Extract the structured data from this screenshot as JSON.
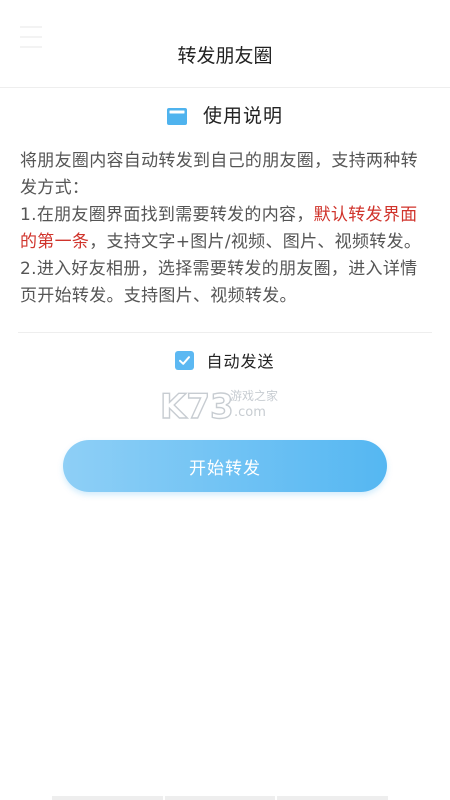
{
  "header": {
    "title": "转发朋友圈"
  },
  "instructions": {
    "title": "使用说明",
    "icon": "folder-icon",
    "accent_color": "#5cb8f2",
    "text_part1": "将朋友圈内容自动转发到自己的朋友圈，支持两种转发方式：",
    "text_part2": "1.在朋友圈界面找到需要转发的内容，",
    "text_highlight": "默认转发界面的第一条",
    "text_part3": "，支持文字+图片/视频、图片、视频转发。",
    "text_part4": "2.进入好友相册，选择需要转发的朋友圈，进入详情页开始转发。支持图片、视频转发。",
    "highlight_color": "#d0342c"
  },
  "auto_send": {
    "label": "自动发送",
    "checked": true
  },
  "watermark": {
    "main": "K73",
    "sub": "游戏之家",
    "domain": ".com"
  },
  "start_button": {
    "label": "开始转发",
    "gradient_start": "#8ecff6",
    "gradient_end": "#55b7f2"
  }
}
